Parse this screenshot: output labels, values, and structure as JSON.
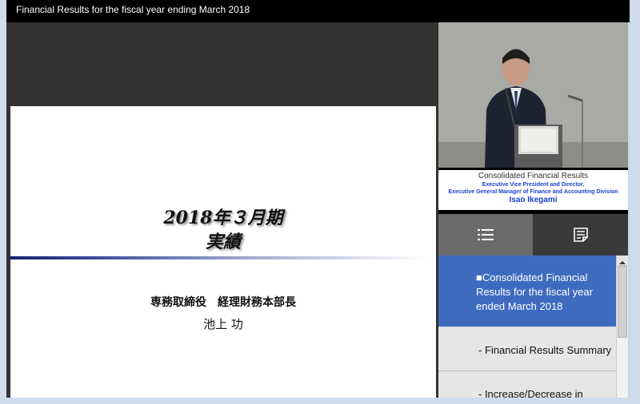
{
  "window": {
    "title": "Financial Results for the fiscal year ending March 2018"
  },
  "slide": {
    "title_line1": "2018年３月期",
    "title_line2": "実績",
    "presenter_role": "専務取締役　経理財務本部長",
    "presenter_name": "池上 功"
  },
  "caption": {
    "line1": "Consolidated Financial Results",
    "line2": "Executive Vice President and Director,",
    "line3": "Executive General Manager of Finance and Accounting Division",
    "line4": "Isao Ikegami"
  },
  "tabs": [
    {
      "name": "chapter-list",
      "icon": "list-icon",
      "active": true
    },
    {
      "name": "notes",
      "icon": "notes-icon",
      "active": false
    }
  ],
  "toc": {
    "items": [
      {
        "label": "■Consolidated Financial Results for the fiscal year ended March 2018",
        "active": true
      },
      {
        "label": "- Financial Results Summary",
        "active": false
      },
      {
        "label": "- Increase/Decrease in",
        "active": false
      }
    ]
  },
  "colors": {
    "titlebar": "#000000",
    "player_bg": "#323232",
    "toc_active": "#3f6bbf",
    "caption_text": "#1a3fd0"
  }
}
